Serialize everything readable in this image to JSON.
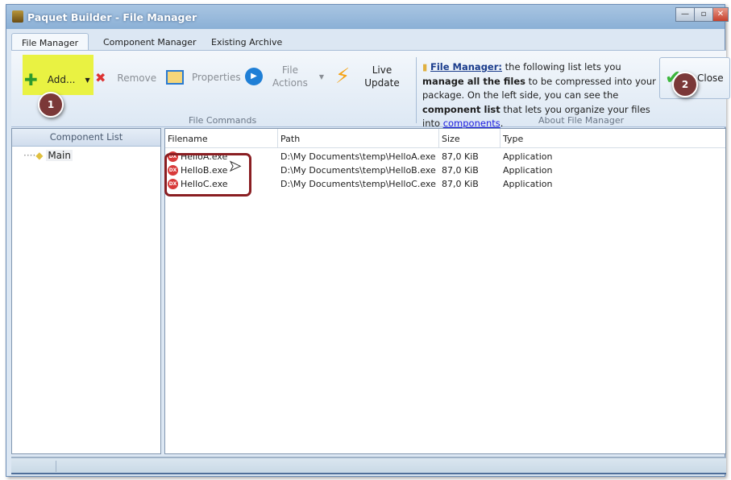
{
  "window": {
    "title": "Paquet Builder - File Manager"
  },
  "tabs": [
    {
      "label": "File Manager",
      "active": true
    },
    {
      "label": "Component Manager"
    },
    {
      "label": "Existing Archive"
    }
  ],
  "ribbon": {
    "add": "Add...",
    "remove": "Remove",
    "properties": "Properties",
    "file_actions_1": "File",
    "file_actions_2": "Actions",
    "live_1": "Live",
    "live_2": "Update",
    "group_file": "File Commands",
    "group_about": "About File Manager",
    "about": {
      "lead": "File Manager:",
      "t1": " the following list lets you ",
      "b1": "manage all the files",
      "t2": " to be compressed into your package. On the left side, you can see the ",
      "b2": "component list",
      "t3": " that lets you organize your files into ",
      "link": "components",
      "t4": "."
    },
    "close": "Close"
  },
  "annotations": [
    "1",
    "2"
  ],
  "component_list": {
    "header": "Component List",
    "items": [
      "Main"
    ]
  },
  "files": {
    "columns": [
      "Filename",
      "Path",
      "Size",
      "Type"
    ],
    "rows": [
      {
        "name": "HelloA.exe",
        "path": "D:\\My Documents\\temp\\HelloA.exe",
        "size": "87,0 KiB",
        "type": "Application"
      },
      {
        "name": "HelloB.exe",
        "path": "D:\\My Documents\\temp\\HelloB.exe",
        "size": "87,0 KiB",
        "type": "Application"
      },
      {
        "name": "HelloC.exe",
        "path": "D:\\My Documents\\temp\\HelloC.exe",
        "size": "87,0 KiB",
        "type": "Application"
      }
    ]
  },
  "colors": {
    "highlight": "#e9f242",
    "annotation": "#7b3838",
    "accent": "#dce7f3"
  }
}
